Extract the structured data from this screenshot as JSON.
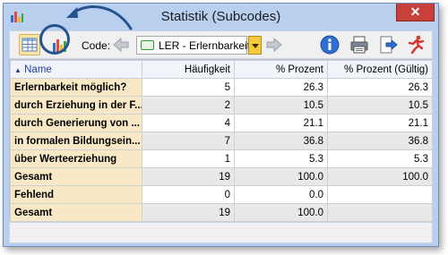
{
  "window": {
    "title": "Statistik (Subcodes)",
    "close_label": "✕"
  },
  "toolbar": {
    "code_label": "Code:",
    "selected_code": "LER - Erlernbarkeit"
  },
  "table": {
    "sort_indicator": "▲",
    "columns": [
      "Name",
      "Häufigkeit",
      "% Prozent",
      "% Prozent (Gültig)"
    ],
    "rows": [
      {
        "name": "Erlernbarkeit möglich?",
        "freq": "5",
        "pct": "26.3",
        "valid": "26.3"
      },
      {
        "name": "durch Erziehung in der F...",
        "freq": "2",
        "pct": "10.5",
        "valid": "10.5"
      },
      {
        "name": "durch Generierung von ...",
        "freq": "4",
        "pct": "21.1",
        "valid": "21.1"
      },
      {
        "name": "in formalen Bildungsein...",
        "freq": "7",
        "pct": "36.8",
        "valid": "36.8"
      },
      {
        "name": "über Werteerziehung",
        "freq": "1",
        "pct": "5.3",
        "valid": "5.3"
      },
      {
        "name": "Gesamt",
        "freq": "19",
        "pct": "100.0",
        "valid": "100.0"
      },
      {
        "name": "Fehlend",
        "freq": "0",
        "pct": "0.0",
        "valid": ""
      },
      {
        "name": "Gesamt",
        "freq": "19",
        "pct": "100.0",
        "valid": ""
      }
    ]
  },
  "colors": {
    "accent": "#23548f",
    "name_cell_bg": "#f9e8c5",
    "dropdown": "#f5cb3d",
    "close": "#c7403a"
  },
  "icons": {
    "app": "bar-chart-icon",
    "table_view": "table-icon",
    "chart_view": "bar-chart-icon",
    "prev": "arrow-left-icon",
    "next": "arrow-right-icon",
    "info": "info-icon",
    "print": "printer-icon",
    "export": "export-icon",
    "exit": "running-man-icon"
  }
}
